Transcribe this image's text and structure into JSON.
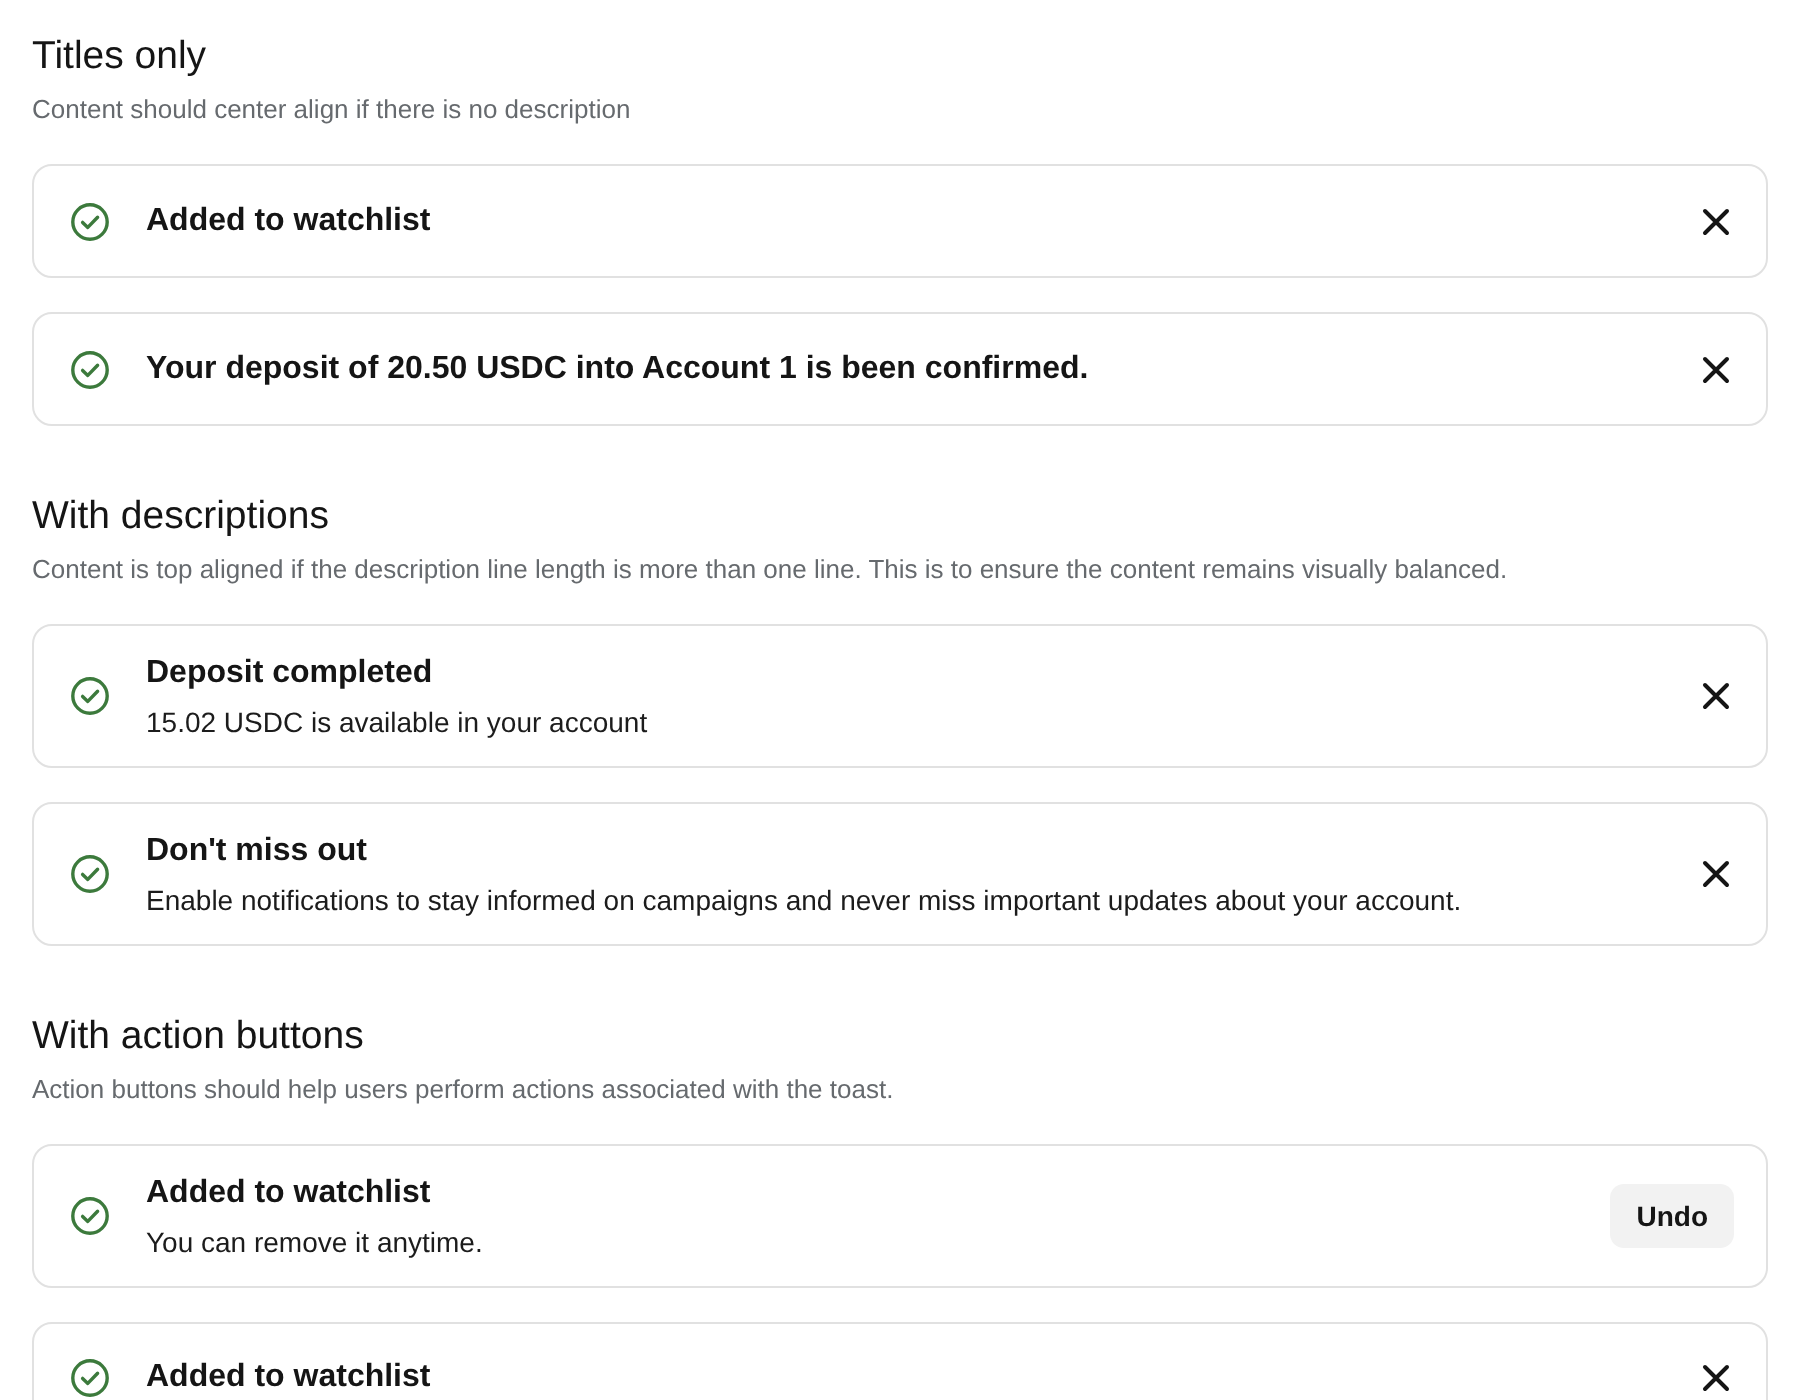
{
  "sections": [
    {
      "title": "Titles only",
      "description": "Content should center align if there is no description",
      "toasts": [
        {
          "title": "Added to watchlist",
          "kind": "close"
        },
        {
          "title": "Your deposit of 20.50 USDC into Account 1 is been confirmed.",
          "kind": "close"
        }
      ]
    },
    {
      "title": "With descriptions",
      "description": "Content is top aligned if the description line length is more than one line. This is to ensure the content remains visually balanced.",
      "toasts": [
        {
          "title": "Deposit completed",
          "description": "15.02 USDC is available in your account",
          "kind": "close"
        },
        {
          "title": "Don't miss out",
          "description": "Enable notifications to stay informed on campaigns and never miss important updates about your account.",
          "kind": "close"
        }
      ]
    },
    {
      "title": "With action buttons",
      "description": "Action buttons should help users perform actions associated with the toast.",
      "toasts": [
        {
          "title": "Added to watchlist",
          "description": "You can remove it anytime.",
          "kind": "action",
          "button_label": "Undo"
        },
        {
          "title": "Added to watchlist",
          "kind": "close"
        }
      ]
    }
  ]
}
